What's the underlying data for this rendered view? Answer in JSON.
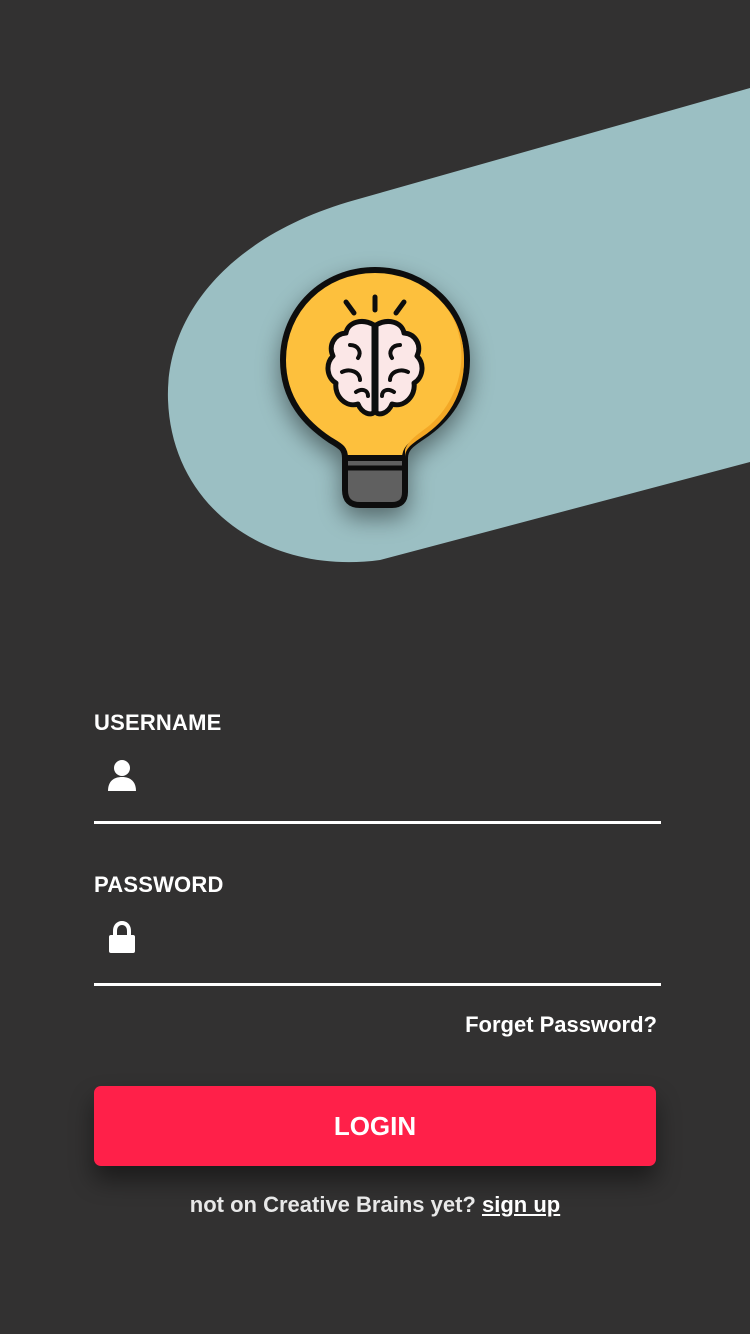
{
  "app": {
    "name": "Creative Brains"
  },
  "colors": {
    "background": "#323131",
    "hero_band": "#9bbfc3",
    "bulb": "#fdc03c",
    "bulb_shade": "#f3a828",
    "brain": "#fbe7e7",
    "accent": "#ff2049",
    "text": "#ffffff"
  },
  "hero": {
    "logo_icon": "lightbulb-brain-icon"
  },
  "form": {
    "username": {
      "label": "USERNAME",
      "value": "",
      "placeholder": "",
      "icon": "user-icon"
    },
    "password": {
      "label": "PASSWORD",
      "value": "",
      "placeholder": "",
      "icon": "lock-icon"
    },
    "forgot_password": "Forget Password?",
    "login_button": "LOGIN"
  },
  "signup": {
    "prompt": "not on Creative Brains yet?",
    "link": "sign up"
  }
}
